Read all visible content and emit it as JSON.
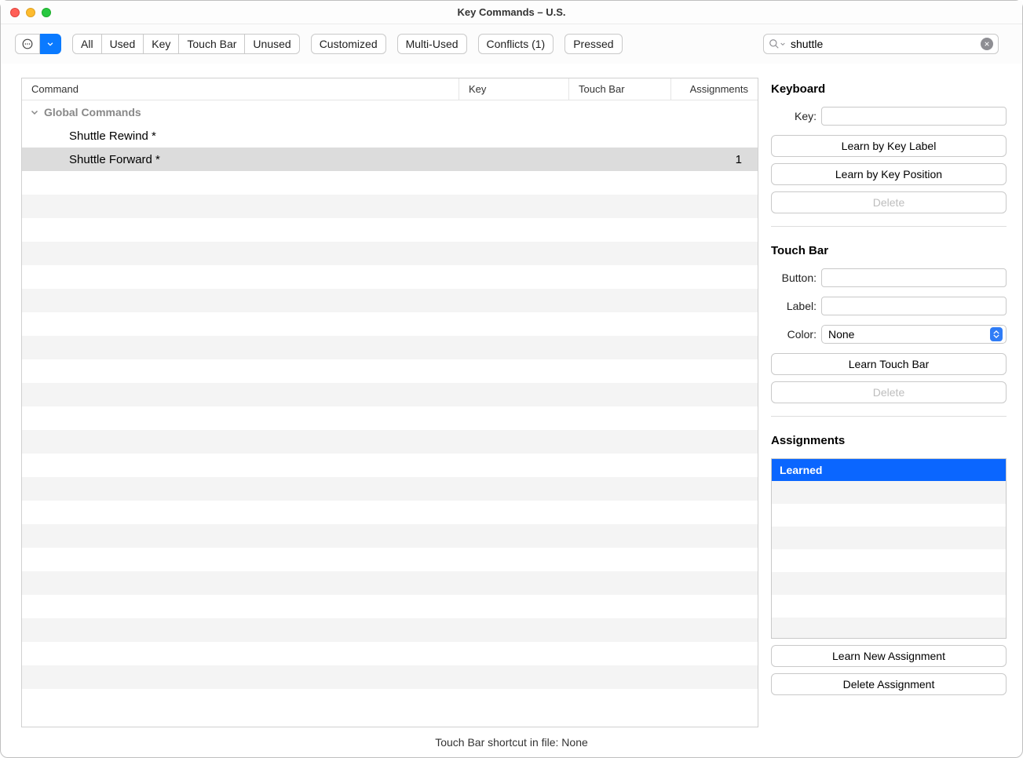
{
  "window": {
    "title": "Key Commands – U.S."
  },
  "toolbar": {
    "filters": [
      "All",
      "Used",
      "Key",
      "Touch Bar",
      "Unused"
    ],
    "customized": "Customized",
    "multi_used": "Multi-Used",
    "conflicts": "Conflicts (1)",
    "pressed": "Pressed"
  },
  "search": {
    "value": "shuttle"
  },
  "table": {
    "columns": {
      "command": "Command",
      "key": "Key",
      "touchbar": "Touch Bar",
      "assignments": "Assignments"
    },
    "group_label": "Global Commands",
    "rows": [
      {
        "command": "Shuttle Rewind *",
        "assignments": "",
        "selected": false
      },
      {
        "command": "Shuttle Forward *",
        "assignments": "1",
        "selected": true
      }
    ]
  },
  "keyboard": {
    "title": "Keyboard",
    "key_label": "Key:",
    "learn_label": "Learn by Key Label",
    "learn_position": "Learn by Key Position",
    "delete": "Delete"
  },
  "touchbar": {
    "title": "Touch Bar",
    "button_label": "Button:",
    "label_label": "Label:",
    "color_label": "Color:",
    "color_value": "None",
    "learn": "Learn Touch Bar",
    "delete": "Delete"
  },
  "assignments": {
    "title": "Assignments",
    "list_header": "Learned",
    "learn_new": "Learn New Assignment",
    "delete": "Delete Assignment"
  },
  "status": {
    "text": "Touch Bar shortcut in file: None"
  }
}
